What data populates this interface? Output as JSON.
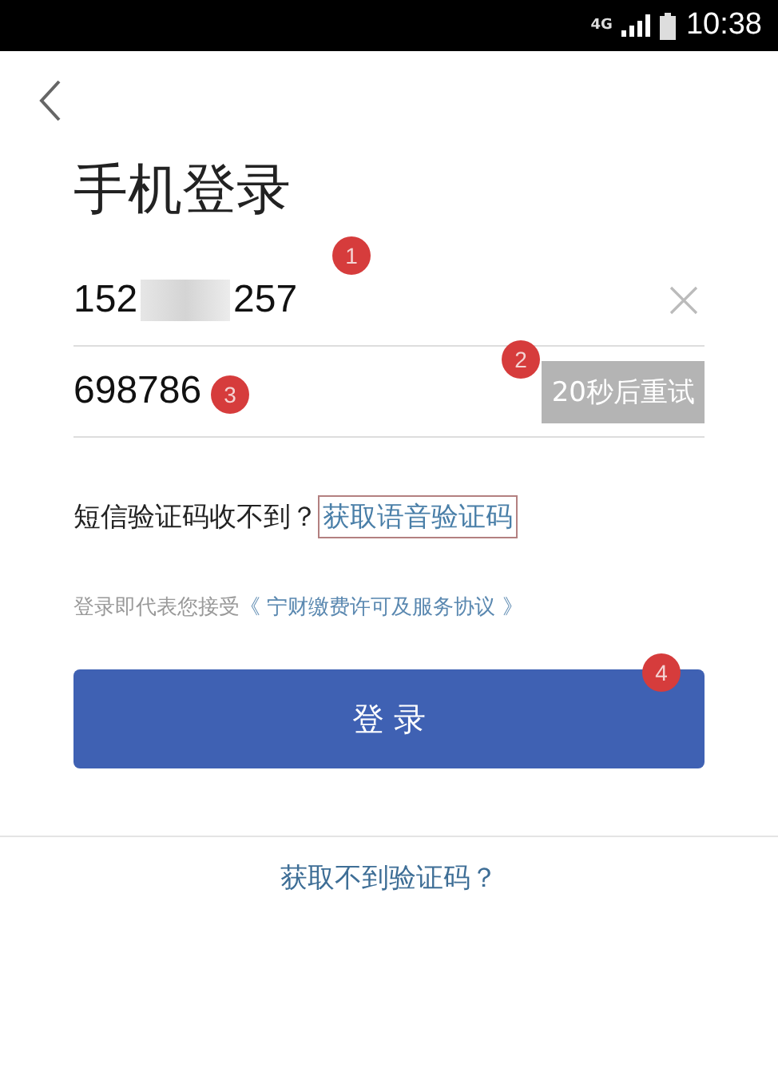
{
  "status_bar": {
    "network": "4G",
    "time": "10:38"
  },
  "title": "手机登录",
  "phone": {
    "prefix": "152",
    "suffix": "257",
    "redacted": true
  },
  "code": {
    "value": "698786",
    "retry_button": {
      "label": "20秒后重试",
      "disabled": true
    }
  },
  "voice_hint": {
    "text": "短信验证码收不到？",
    "link": "获取语音验证码"
  },
  "agreement": {
    "text": "登录即代表您接受",
    "link": "《 宁财缴费许可及服务协议 》"
  },
  "login_button": "登 录",
  "help_link": "获取不到验证码？",
  "markers": [
    {
      "label": "1"
    },
    {
      "label": "2"
    },
    {
      "label": "3"
    },
    {
      "label": "4"
    }
  ]
}
